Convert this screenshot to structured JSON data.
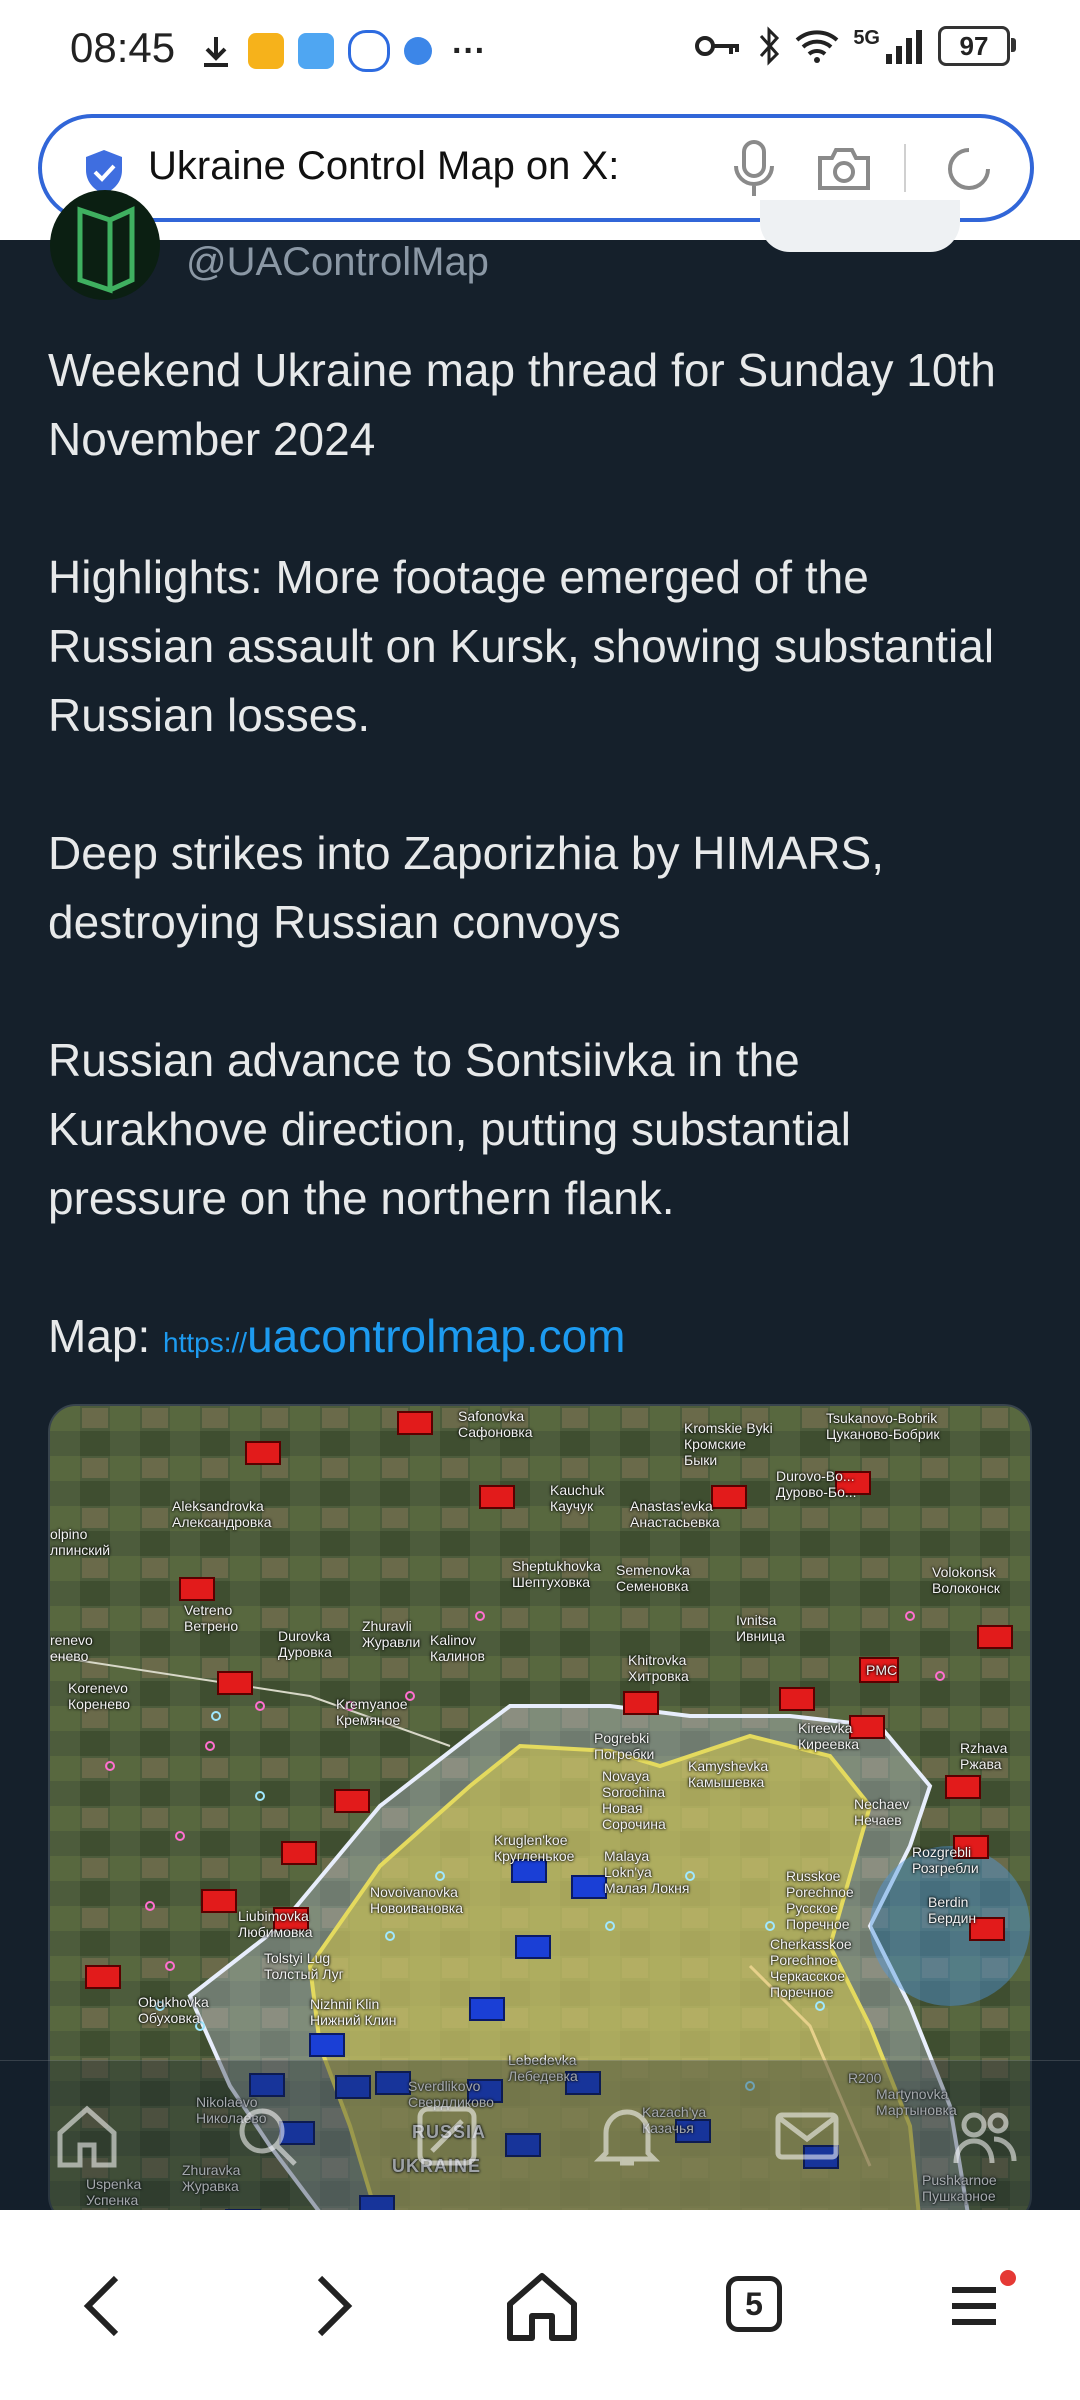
{
  "status_bar": {
    "time": "08:45",
    "network": "5G",
    "battery": "97",
    "more": "···"
  },
  "address_bar": {
    "text": "Ukraine Control Map on X:"
  },
  "tweet": {
    "handle": "@UAControlMap",
    "paragraphs": {
      "p1": "Weekend Ukraine map thread for Sunday 10th November 2024",
      "p2": "Highlights: More footage emerged of the Russian assault on Kursk, showing substantial Russian losses.",
      "p3": "Deep strikes into Zaporizhia by HIMARS, destroying Russian convoys",
      "p4": "Russian advance to Sontsiivka in the Kurakhove direction, putting substantial pressure on the northern flank."
    },
    "map_prefix": "Map: ",
    "link_scheme": "https://",
    "link_domain": "uacontrolmap.com"
  },
  "map": {
    "labels": {
      "safonovka": "Safonovka\nСафоновка",
      "kromskie": "Kromskie Byki\nКромские\nБыки",
      "tsukanovo": "Tsukanovo-Bobrik\nЦуканово-Бобрик",
      "durovo": "Durovo-Bo...\nДурово-Бо...",
      "aleksandrovka": "Aleksandrovka\nАлександровка",
      "kauchuk": "Kauchuk\nКаучук",
      "anastas": "Anastas'evka\nАнастасьевка",
      "olpino": "olpino\nлпинский",
      "sheptukhovka": "Sheptukhovka\nШептуховка",
      "semenovka": "Semenovka\nСеменовка",
      "volokonsk": "Volokonsk\nВолоконск",
      "vetreno": "Vetreno\nВетрено",
      "zhuravli": "Zhuravli\nЖуравли",
      "durovka": "Durovka\nДуровка",
      "kalinov": "Kalinov\nКалинов",
      "ivnitsa": "Ivnitsa\nИвница",
      "korenevo": "Korenevo\nКоренево",
      "krenevo": "renevo\nенево",
      "khitrovka": "Khitrovka\nХитровка",
      "kremyanoe": "Kremyanoe\nКремяное",
      "pogrebki": "Pogrebki\nПогребки",
      "kireevka": "Kireevka\nКиреевка",
      "rzhava": "Rzhava\nРжава",
      "kamyshevka": "Kamyshevka\nКамышевка",
      "novaya": "Novaya\nSorochina\nНовая\nСорочина",
      "nechaev": "Nechaev\nНечаев",
      "kruglenkoe": "Kruglen'koe\nКругленькое",
      "malaya": "Malaya\nLokn'ya\nМалая Локня",
      "russkoe": "Russkoe\nPorechnoe\nРусское\nПоречное",
      "rozgrebli": "Rozgrebli\nРозгребли",
      "berdin": "Berdin\nБердин",
      "novoivanovka": "Novoivanovka\nНовоивановка",
      "liubimovka": "Liubimovka\nЛюбимовка",
      "tolstyi": "Tolstyi Lug\nТолстый Луг",
      "cherkasskoe": "Cherkasskoe\nPorechnoe\nЧеркасское\nПоречное",
      "nizhnii": "Nizhnii Klin\nНижний Клин",
      "obukhovka": "Obukhovka\nОбуховка",
      "lebedevka": "Lebedevka\nЛебедевка",
      "sverdlikovo": "Sverdlikovo\nСвердликово",
      "nikolaevo": "Nikolaevo\nНиколаево",
      "kazachya": "Kazach'ya\nКазачья",
      "martynovka": "Martynovka\nМартыновка",
      "pushkarnoe": "Pushkarnoe\nПушкарное",
      "uspenka": "Uspenka\nУспенка",
      "zhuravka": "Zhuravka\nЖуравка",
      "russia": "RUSSIA",
      "ukraine": "UKRAINE",
      "pmc": "PMC",
      "road": "R200"
    }
  },
  "browser": {
    "tab_count": "5"
  },
  "colors": {
    "background": "#15202b",
    "text": "#e7e9ea",
    "muted": "#8b98a5",
    "link": "#1d9bf0",
    "accent": "#3166d8",
    "russian_unit": "#e21b1b",
    "ukrainian_unit": "#1a3fd6",
    "held_area": "#d6c94a"
  }
}
